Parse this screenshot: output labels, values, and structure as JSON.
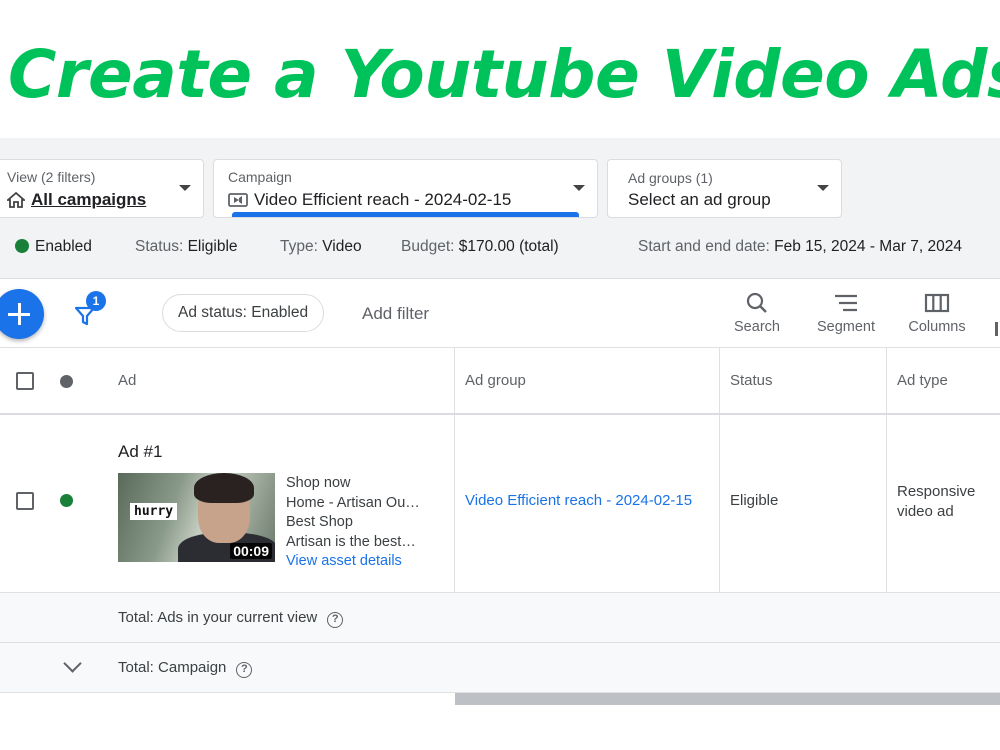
{
  "headline": "Create a Youtube Video Ads",
  "filters": {
    "view": {
      "label": "View (2 filters)",
      "value": "All campaigns"
    },
    "campaign": {
      "label": "Campaign",
      "value": "Video Efficient reach - 2024-02-15"
    },
    "ad_groups": {
      "label": "Ad groups (1)",
      "value": "Select an ad group"
    }
  },
  "status_line": {
    "enabled": "Enabled",
    "status_label": "Status:",
    "status_value": "Eligible",
    "type_label": "Type:",
    "type_value": "Video",
    "budget_label": "Budget:",
    "budget_value": "$170.00 (total)",
    "dates_label": "Start and end date:",
    "dates_value": "Feb 15, 2024 - Mar 7, 2024"
  },
  "toolbar": {
    "filter_count": "1",
    "chip": "Ad status: Enabled",
    "add_filter": "Add filter",
    "search": "Search",
    "segment": "Segment",
    "columns": "Columns"
  },
  "table": {
    "headers": {
      "ad": "Ad",
      "ad_group": "Ad group",
      "status": "Status",
      "ad_type": "Ad type"
    },
    "rows": [
      {
        "ad_title": "Ad #1",
        "thumb_text": "hurry",
        "duration": "00:09",
        "lines": [
          "Shop now",
          "Home - Artisan Ou…",
          "Best Shop",
          "Artisan is the best…"
        ],
        "asset_link": "View asset details",
        "ad_group": "Video Efficient reach - 2024-02-15",
        "status": "Eligible",
        "ad_type": "Responsive video ad"
      }
    ],
    "totals": {
      "current_view": "Total: Ads in your current view",
      "campaign": "Total: Campaign"
    }
  },
  "colors": {
    "headline": "#00c25a",
    "accent": "#1a73e8",
    "enabled": "#188038"
  }
}
